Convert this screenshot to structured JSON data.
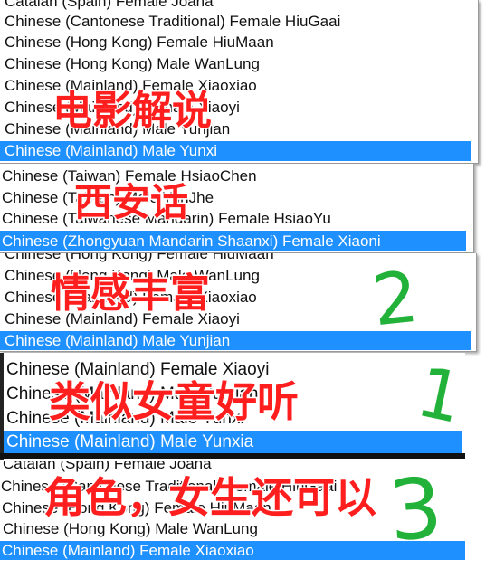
{
  "panel1": {
    "options": [
      "Catalan (Spain) Female Joana",
      "Chinese (Cantonese Traditional) Female HiuGaai",
      "Chinese (Hong Kong) Female HiuMaan",
      "Chinese (Hong Kong) Male WanLung",
      "Chinese (Mainland) Female Xiaoxiao",
      "Chinese (Mainland) Female Xiaoyi",
      "Chinese (Mainland) Male Yunjian",
      "Chinese (Mainland) Male Yunxi"
    ],
    "overlay": "电影解说"
  },
  "panel2": {
    "options": [
      "Chinese (Taiwan) Female HsiaoChen",
      "Chinese (Taiwan) Male YunJhe",
      "Chinese (Taiwanese Mandarin) Female HsiaoYu",
      "Chinese (Zhongyuan Mandarin Shaanxi) Female Xiaoni"
    ],
    "overlay": "西安话"
  },
  "panel3": {
    "options": [
      "Chinese (Hong Kong) Female HiuMaan",
      "Chinese (Hong Kong) Male WanLung",
      "Chinese (Mainland) Female Xiaoxiao",
      "Chinese (Mainland) Female Xiaoyi",
      "Chinese (Mainland) Male Yunjian"
    ],
    "overlay": "情感丰富",
    "mark": "2"
  },
  "panel4": {
    "options": [
      "Chinese (Mainland) Female Xiaoyi",
      "Chinese (Mainland) Male Yunjian",
      "Chinese (Mainland) Male Yunxi",
      "Chinese (Mainland) Male Yunxia"
    ],
    "overlay": "类似女童好听",
    "mark": "1"
  },
  "panel5": {
    "options": [
      "Catalan (Spain) Female Joana",
      "Chinese (Cantonese Traditional) Female HiuGaai",
      "Chinese (Hong Kong) Female HiuMaan",
      "Chinese (Hong Kong) Male WanLung",
      "Chinese (Mainland) Female Xiaoxiao"
    ],
    "overlay": "角色，女生还可以",
    "mark": "3"
  },
  "colors": {
    "selected": "#1e90ff",
    "overlay": "#ff1e1e",
    "mark": "#22b23a"
  }
}
